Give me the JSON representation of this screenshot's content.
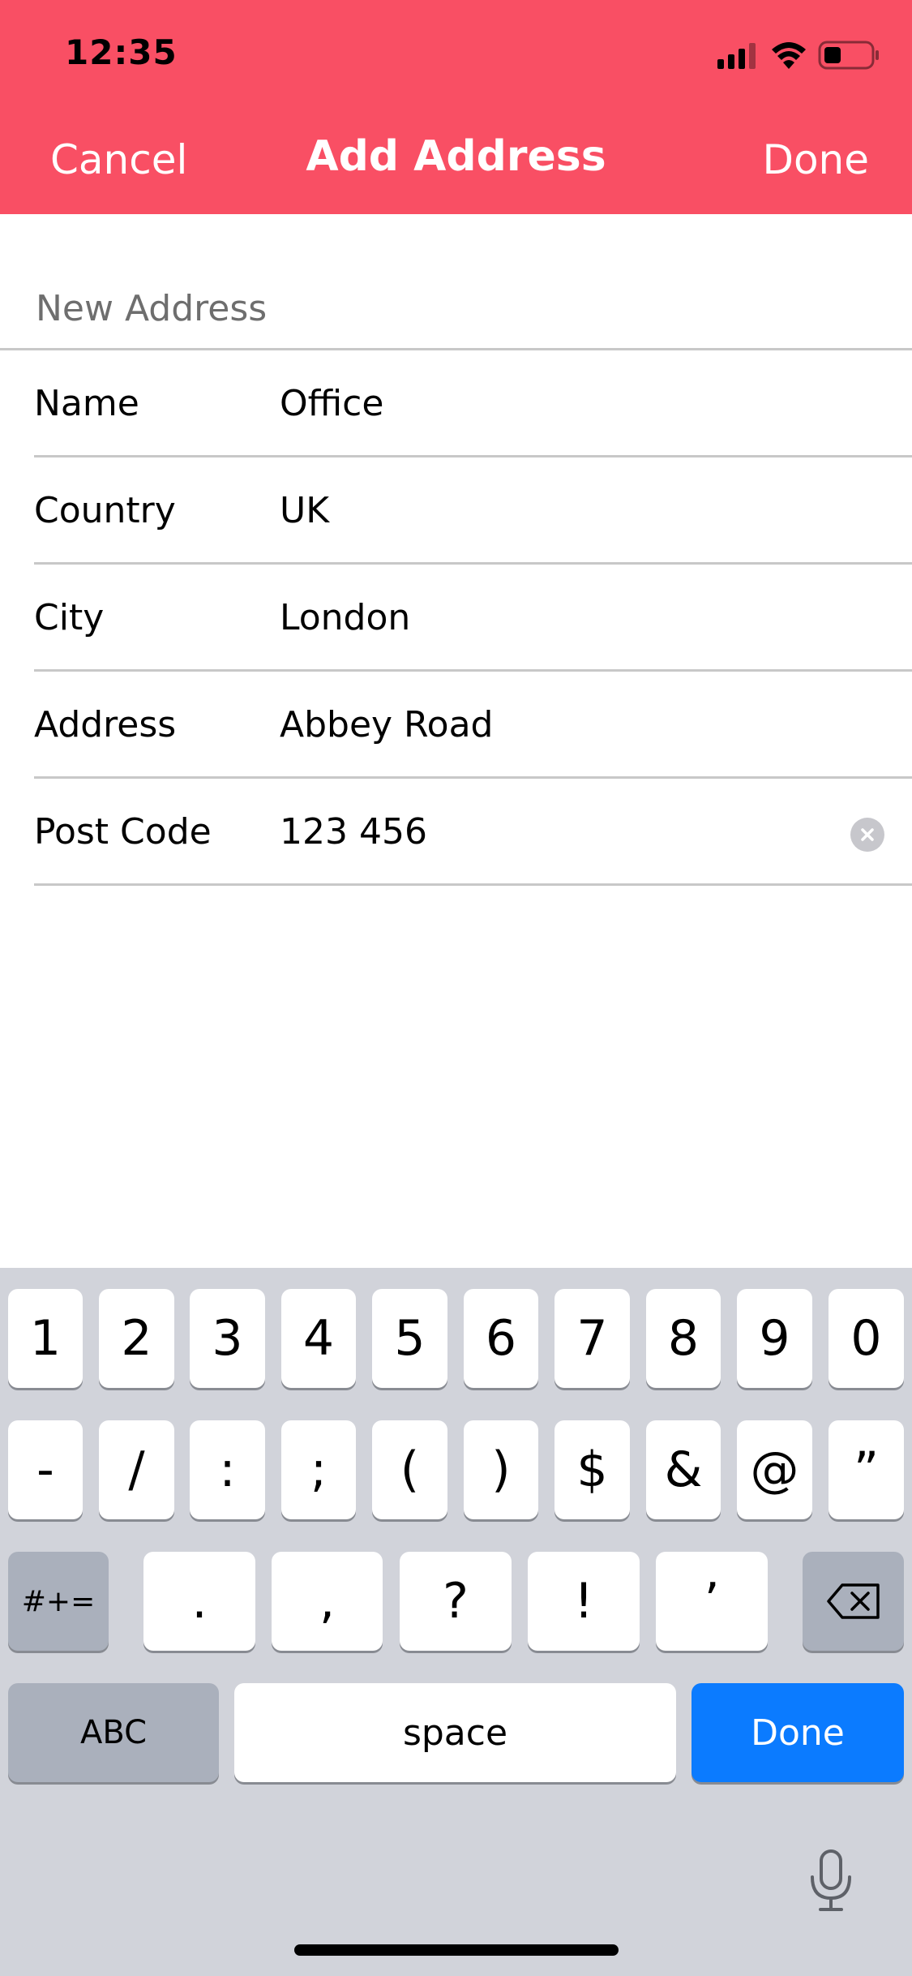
{
  "status_bar": {
    "time": "12:35",
    "signal_icon": "cellular-signal-icon",
    "wifi_icon": "wifi-icon",
    "battery_icon": "battery-icon"
  },
  "nav": {
    "cancel_label": "Cancel",
    "title": "Add Address",
    "done_label": "Done"
  },
  "form": {
    "section_title": "New Address",
    "fields": [
      {
        "label": "Name",
        "value": "Office"
      },
      {
        "label": "Country",
        "value": "UK"
      },
      {
        "label": "City",
        "value": "London"
      },
      {
        "label": "Address",
        "value": "Abbey Road"
      },
      {
        "label": "Post Code",
        "value": "123 456"
      }
    ],
    "clear_icon": "clear-text-icon"
  },
  "keyboard": {
    "row1": [
      "1",
      "2",
      "3",
      "4",
      "5",
      "6",
      "7",
      "8",
      "9",
      "0"
    ],
    "row2": [
      "-",
      "/",
      ":",
      ";",
      "(",
      ")",
      "$",
      "&",
      "@",
      "”"
    ],
    "symbols_toggle": "#+=",
    "row3": [
      ".",
      ",",
      "?",
      "!",
      "’"
    ],
    "delete_icon": "backspace-icon",
    "abc_label": "ABC",
    "space_label": "space",
    "done_label": "Done",
    "mic_icon": "microphone-icon",
    "colors": {
      "return_key": "#0b7bff",
      "background": "#d1d3da"
    }
  },
  "theme": {
    "accent": "#f94f64"
  }
}
